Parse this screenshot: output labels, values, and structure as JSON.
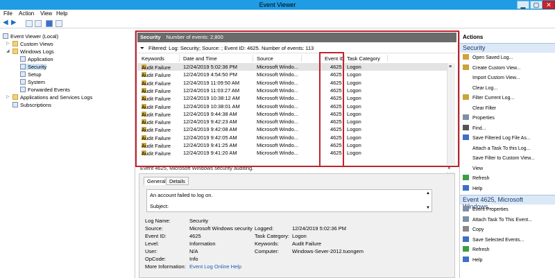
{
  "window": {
    "title": "Event Viewer",
    "min": "▁",
    "max": "▢",
    "close": "✕"
  },
  "menu": [
    "File",
    "Action",
    "View",
    "Help"
  ],
  "tree": [
    {
      "label": "Event Viewer (Local)",
      "level": 0,
      "icon": "computer-icon"
    },
    {
      "label": "Custom Views",
      "level": 1,
      "icon": "folder-icon"
    },
    {
      "label": "Windows Logs",
      "level": 1,
      "icon": "folder-icon"
    },
    {
      "label": "Application",
      "level": 2,
      "icon": "log-icon"
    },
    {
      "label": "Security",
      "level": 2,
      "icon": "log-icon",
      "selected": true
    },
    {
      "label": "Setup",
      "level": 2,
      "icon": "log-icon"
    },
    {
      "label": "System",
      "level": 2,
      "icon": "log-icon"
    },
    {
      "label": "Forwarded Events",
      "level": 2,
      "icon": "log-icon"
    },
    {
      "label": "Applications and Services Logs",
      "level": 1,
      "icon": "folder-icon"
    },
    {
      "label": "Subscriptions",
      "level": 1,
      "icon": "subscriptions-icon"
    }
  ],
  "log": {
    "name": "Security",
    "count_label": "Number of events: 2,800"
  },
  "filter": {
    "text": "Filtered: Log: Security; Source: ; Event ID: 4625. Number of events: 113"
  },
  "columns": {
    "keywords": "Keywords",
    "datetime": "Date and Time",
    "source": "Source",
    "eventid": "Event ID",
    "category": "Task Category"
  },
  "events": [
    {
      "keywords": "Audit Failure",
      "datetime": "12/24/2019 5:02:36 PM",
      "source": "Microsoft Windo...",
      "eventid": "4625",
      "category": "Logon"
    },
    {
      "keywords": "Audit Failure",
      "datetime": "12/24/2019 4:54:50 PM",
      "source": "Microsoft Windo...",
      "eventid": "4625",
      "category": "Logon"
    },
    {
      "keywords": "Audit Failure",
      "datetime": "12/24/2019 11:09:50 AM",
      "source": "Microsoft Windo...",
      "eventid": "4625",
      "category": "Logon"
    },
    {
      "keywords": "Audit Failure",
      "datetime": "12/24/2019 11:03:27 AM",
      "source": "Microsoft Windo...",
      "eventid": "4625",
      "category": "Logon"
    },
    {
      "keywords": "Audit Failure",
      "datetime": "12/24/2019 10:38:12 AM",
      "source": "Microsoft Windo...",
      "eventid": "4625",
      "category": "Logon"
    },
    {
      "keywords": "Audit Failure",
      "datetime": "12/24/2019 10:38:01 AM",
      "source": "Microsoft Windo...",
      "eventid": "4625",
      "category": "Logon"
    },
    {
      "keywords": "Audit Failure",
      "datetime": "12/24/2019 9:44:38 AM",
      "source": "Microsoft Windo...",
      "eventid": "4625",
      "category": "Logon"
    },
    {
      "keywords": "Audit Failure",
      "datetime": "12/24/2019 9:42:23 AM",
      "source": "Microsoft Windo...",
      "eventid": "4625",
      "category": "Logon"
    },
    {
      "keywords": "Audit Failure",
      "datetime": "12/24/2019 9:42:08 AM",
      "source": "Microsoft Windo...",
      "eventid": "4625",
      "category": "Logon"
    },
    {
      "keywords": "Audit Failure",
      "datetime": "12/24/2019 9:42:05 AM",
      "source": "Microsoft Windo...",
      "eventid": "4625",
      "category": "Logon"
    },
    {
      "keywords": "Audit Failure",
      "datetime": "12/24/2019 9:41:25 AM",
      "source": "Microsoft Windo...",
      "eventid": "4625",
      "category": "Logon"
    },
    {
      "keywords": "Audit Failure",
      "datetime": "12/24/2019 9:41:20 AM",
      "source": "Microsoft Windo...",
      "eventid": "4625",
      "category": "Logon"
    }
  ],
  "detail": {
    "header": "Event 4625, Microsoft Windows security auditing.",
    "close": "×",
    "tabs": [
      "General",
      "Details"
    ],
    "description": "An account failed to log on.",
    "subject": "Subject:",
    "fields": {
      "log_name_label": "Log Name:",
      "log_name": "Security",
      "source_label": "Source:",
      "source": "Microsoft Windows security",
      "logged_label": "Logged:",
      "logged": "12/24/2019 5:02:36 PM",
      "eventid_label": "Event ID:",
      "eventid": "4625",
      "taskcat_label": "Task Category:",
      "taskcat": "Logon",
      "level_label": "Level:",
      "level": "Information",
      "keywords_label": "Keywords:",
      "keywords": "Audit Failure",
      "user_label": "User:",
      "user": "N/A",
      "computer_label": "Computer:",
      "computer": "Windows-Sever-2012.tuongem",
      "opcode_label": "OpCode:",
      "opcode": "Info",
      "moreinfo_label": "More Information:",
      "moreinfo": "Event Log Online Help"
    }
  },
  "actions": {
    "title": "Actions",
    "section1": "Security",
    "items1": [
      {
        "label": "Open Saved Log...",
        "icon": "open-log-icon"
      },
      {
        "label": "Create Custom View...",
        "icon": "filter-icon"
      },
      {
        "label": "Import Custom View...",
        "icon": ""
      },
      {
        "label": "Clear Log...",
        "icon": ""
      },
      {
        "label": "Filter Current Log...",
        "icon": "filter-icon"
      },
      {
        "label": "Clear Filter",
        "icon": ""
      },
      {
        "label": "Properties",
        "icon": "properties-icon"
      },
      {
        "label": "Find...",
        "icon": "find-icon"
      },
      {
        "label": "Save Filtered Log File As...",
        "icon": "save-icon"
      },
      {
        "label": "Attach a Task To this Log...",
        "icon": ""
      },
      {
        "label": "Save Filter to Custom View...",
        "icon": ""
      },
      {
        "label": "View",
        "icon": ""
      },
      {
        "label": "Refresh",
        "icon": "refresh-icon"
      },
      {
        "label": "Help",
        "icon": "help-icon"
      }
    ],
    "section2": "Event 4625, Microsoft Windows...",
    "items2": [
      {
        "label": "Event Properties",
        "icon": "properties-icon"
      },
      {
        "label": "Attach Task To This Event...",
        "icon": "task-icon"
      },
      {
        "label": "Copy",
        "icon": "copy-icon"
      },
      {
        "label": "Save Selected Events...",
        "icon": "save-icon"
      },
      {
        "label": "Refresh",
        "icon": "refresh-icon"
      },
      {
        "label": "Help",
        "icon": "help-icon"
      }
    ]
  },
  "colors": {
    "accent": "#1f9ce4",
    "highlight": "#c0222c",
    "section": "#dbe8f6"
  }
}
